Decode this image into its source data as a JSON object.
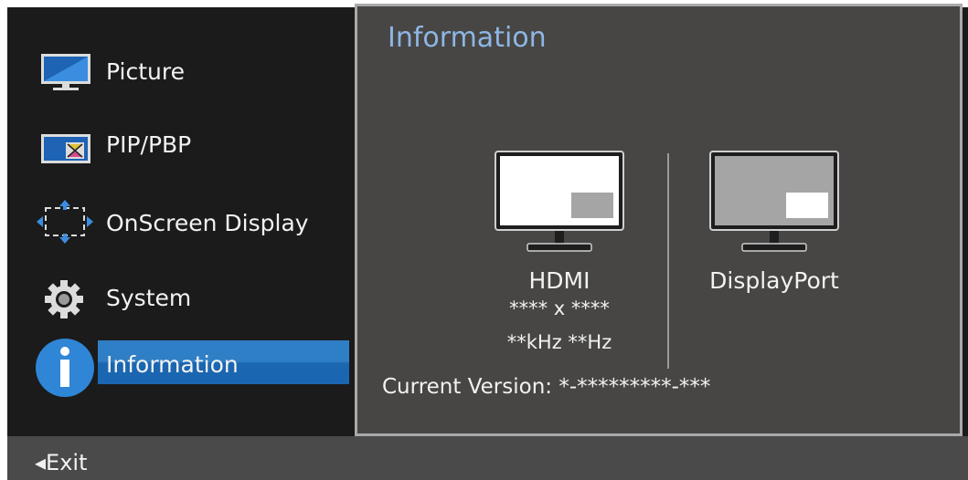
{
  "menu": {
    "items": [
      {
        "label": "Picture",
        "icon": "monitor-icon"
      },
      {
        "label": "PIP/PBP",
        "icon": "pip-icon"
      },
      {
        "label": "OnScreen Display",
        "icon": "onscreen-display-icon"
      },
      {
        "label": "System",
        "icon": "gear-icon"
      },
      {
        "label": "Information",
        "icon": "info-icon",
        "selected": true
      }
    ]
  },
  "panel": {
    "title": "Information",
    "sources": [
      {
        "name": "HDMI",
        "resolution": "**** x ****",
        "frequency": "**kHz **Hz"
      },
      {
        "name": "DisplayPort"
      }
    ],
    "current_version": "Current Version: *-*********-***"
  },
  "footer": {
    "exit_label": "◂Exit"
  },
  "colors": {
    "background": "#1b1b1b",
    "panel": "#474644",
    "accent": "#2f7fc6",
    "title": "#8db6e4",
    "footer": "#4a4a4a"
  }
}
